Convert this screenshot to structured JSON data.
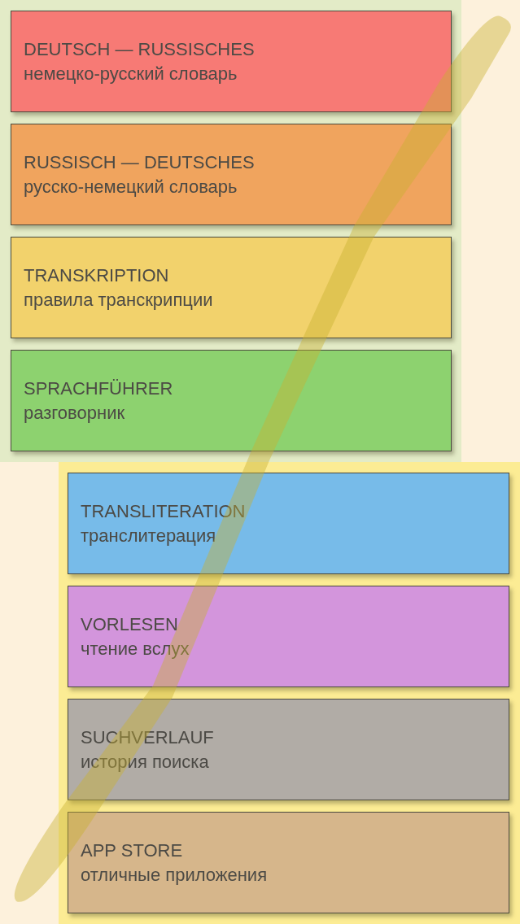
{
  "sections": [
    {
      "color": "#e3ebc7",
      "tiles": [
        {
          "title": "DEUTSCH — RUSSISCHES",
          "subtitle": "немецко-русский словарь",
          "color": "#f77a75"
        },
        {
          "title": "RUSSISCH — DEUTSCHES",
          "subtitle": "русско-немецкий словарь",
          "color": "#f0a45e"
        },
        {
          "title": "TRANSKRIPTION",
          "subtitle": "правила транскрипции",
          "color": "#f2d26c"
        },
        {
          "title": "SPRACHFÜHRER",
          "subtitle": "разговорник",
          "color": "#8dd26f"
        }
      ]
    },
    {
      "color": "#fcec94",
      "tiles": [
        {
          "title": "TRANSLITERATION",
          "subtitle": "транслитерация",
          "color": "#77bbe9"
        },
        {
          "title": "VORLESEN",
          "subtitle": "чтение вслух",
          "color": "#d395dc"
        },
        {
          "title": "SUCHVERLAUF",
          "subtitle": "история поиска",
          "color": "#b1aca6"
        },
        {
          "title": "APP STORE",
          "subtitle": "отличные приложения",
          "color": "#d6b68b"
        }
      ]
    }
  ]
}
